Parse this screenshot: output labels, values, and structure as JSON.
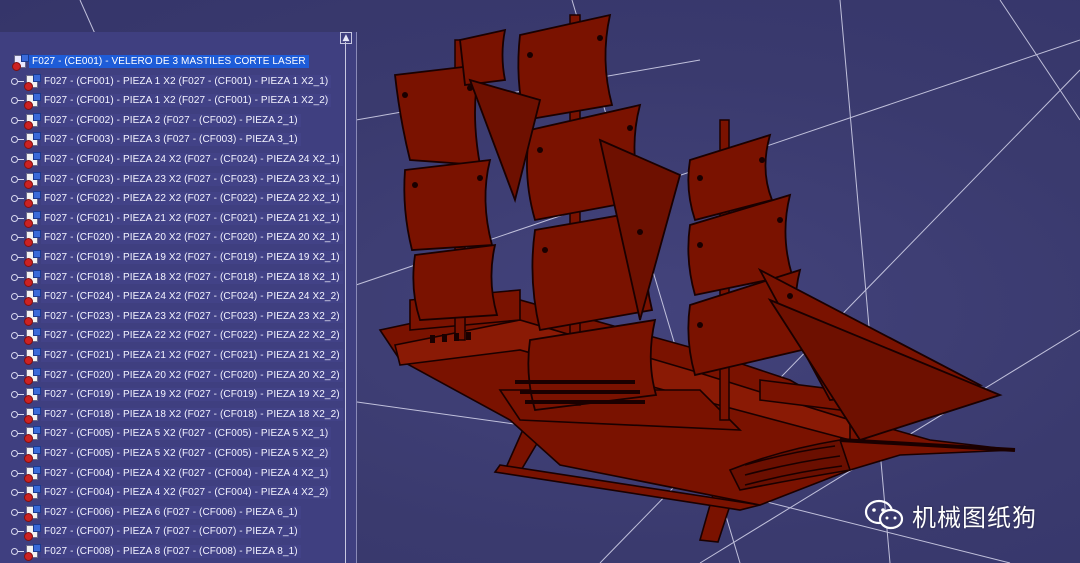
{
  "tree": {
    "root_label": "F027 - (CE001) - VELERO DE 3 MASTILES CORTE LASER",
    "nodes": [
      "F027 - (CF001) - PIEZA 1 X2 (F027 - (CF001) - PIEZA 1 X2_1)",
      "F027 - (CF001) - PIEZA 1 X2 (F027 - (CF001) - PIEZA 1 X2_2)",
      "F027 - (CF002) - PIEZA 2 (F027 - (CF002) - PIEZA 2_1)",
      "F027 - (CF003) - PIEZA 3 (F027 - (CF003) - PIEZA 3_1)",
      "F027 - (CF024) - PIEZA 24 X2 (F027 - (CF024) - PIEZA 24 X2_1)",
      "F027 - (CF023) - PIEZA 23 X2 (F027 - (CF023) - PIEZA 23 X2_1)",
      "F027 - (CF022) - PIEZA 22 X2 (F027 - (CF022) - PIEZA 22 X2_1)",
      "F027 - (CF021) - PIEZA 21 X2 (F027 - (CF021) - PIEZA 21 X2_1)",
      "F027 - (CF020) - PIEZA 20 X2 (F027 - (CF020) - PIEZA 20 X2_1)",
      "F027 - (CF019) - PIEZA 19 X2 (F027 - (CF019) - PIEZA 19 X2_1)",
      "F027 - (CF018) - PIEZA 18 X2 (F027 - (CF018) - PIEZA 18 X2_1)",
      "F027 - (CF024) - PIEZA 24 X2 (F027 - (CF024) - PIEZA 24 X2_2)",
      "F027 - (CF023) - PIEZA 23 X2 (F027 - (CF023) - PIEZA 23 X2_2)",
      "F027 - (CF022) - PIEZA 22 X2 (F027 - (CF022) - PIEZA 22 X2_2)",
      "F027 - (CF021) - PIEZA 21 X2 (F027 - (CF021) - PIEZA 21 X2_2)",
      "F027 - (CF020) - PIEZA 20 X2 (F027 - (CF020) - PIEZA 20 X2_2)",
      "F027 - (CF019) - PIEZA 19 X2 (F027 - (CF019) - PIEZA 19 X2_2)",
      "F027 - (CF018) - PIEZA 18 X2 (F027 - (CF018) - PIEZA 18 X2_2)",
      "F027 - (CF005) - PIEZA 5 X2 (F027 - (CF005) - PIEZA 5 X2_1)",
      "F027 - (CF005) - PIEZA 5 X2 (F027 - (CF005) - PIEZA 5 X2_2)",
      "F027 - (CF004) - PIEZA 4 X2 (F027 - (CF004) - PIEZA 4 X2_1)",
      "F027 - (CF004) - PIEZA 4 X2 (F027 - (CF004) - PIEZA 4 X2_2)",
      "F027 - (CF006) - PIEZA 6 (F027 - (CF006) - PIEZA 6_1)",
      "F027 - (CF007) - PIEZA 7 (F027 - (CF007) - PIEZA 7_1)",
      "F027 - (CF008) - PIEZA 8 (F027 - (CF008) - PIEZA 8_1)"
    ]
  },
  "model": {
    "color": "#7a1200",
    "edge_color": "#1a0000"
  },
  "colors": {
    "background": "#3a3a6e",
    "tree_bg": "#3f3f80",
    "selection": "#1e5cd8"
  },
  "watermark": {
    "text": "机械图纸狗"
  }
}
